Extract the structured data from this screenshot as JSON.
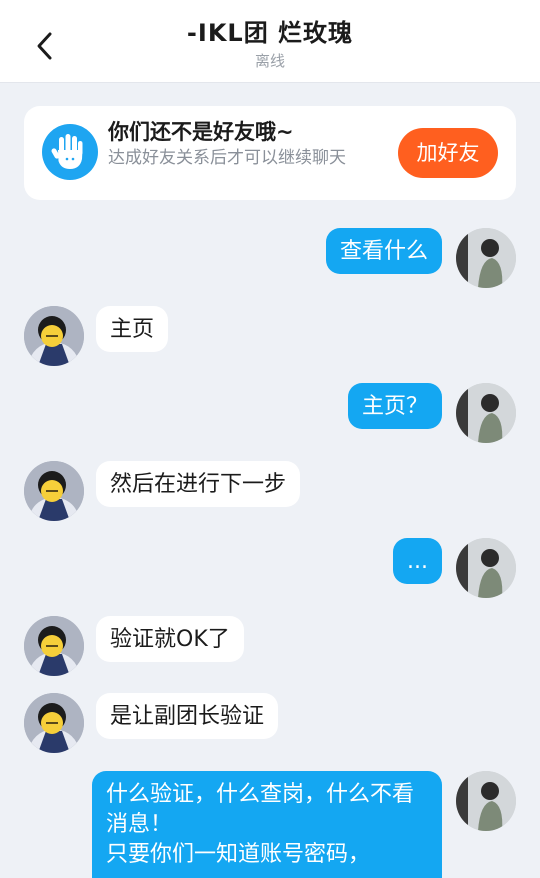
{
  "header": {
    "title": "-IKL团 烂玫瑰",
    "status": "离线"
  },
  "banner": {
    "title": "你们还不是好友哦~",
    "subtitle": "达成好友关系后才可以继续聊天",
    "button_label": "加好友",
    "accent_color": "#ff5f1f",
    "icon_color": "#1ea5f1"
  },
  "messages": [
    {
      "sender": "me",
      "text": "查看什么"
    },
    {
      "sender": "other",
      "text": "主页"
    },
    {
      "sender": "me",
      "text": "主页？"
    },
    {
      "sender": "other",
      "text": "然后在进行下一步"
    },
    {
      "sender": "me",
      "text": "..."
    },
    {
      "sender": "other",
      "text": "验证就OK了"
    },
    {
      "sender": "other",
      "text": "是让副团长验证"
    },
    {
      "sender": "me",
      "text": "什么验证，什么查岗，什么不看消息！\n只要你们一知道账号密码，"
    }
  ],
  "colors": {
    "my_bubble": "#14a7f2",
    "their_bubble": "#ffffff",
    "background": "#eef1f6"
  }
}
